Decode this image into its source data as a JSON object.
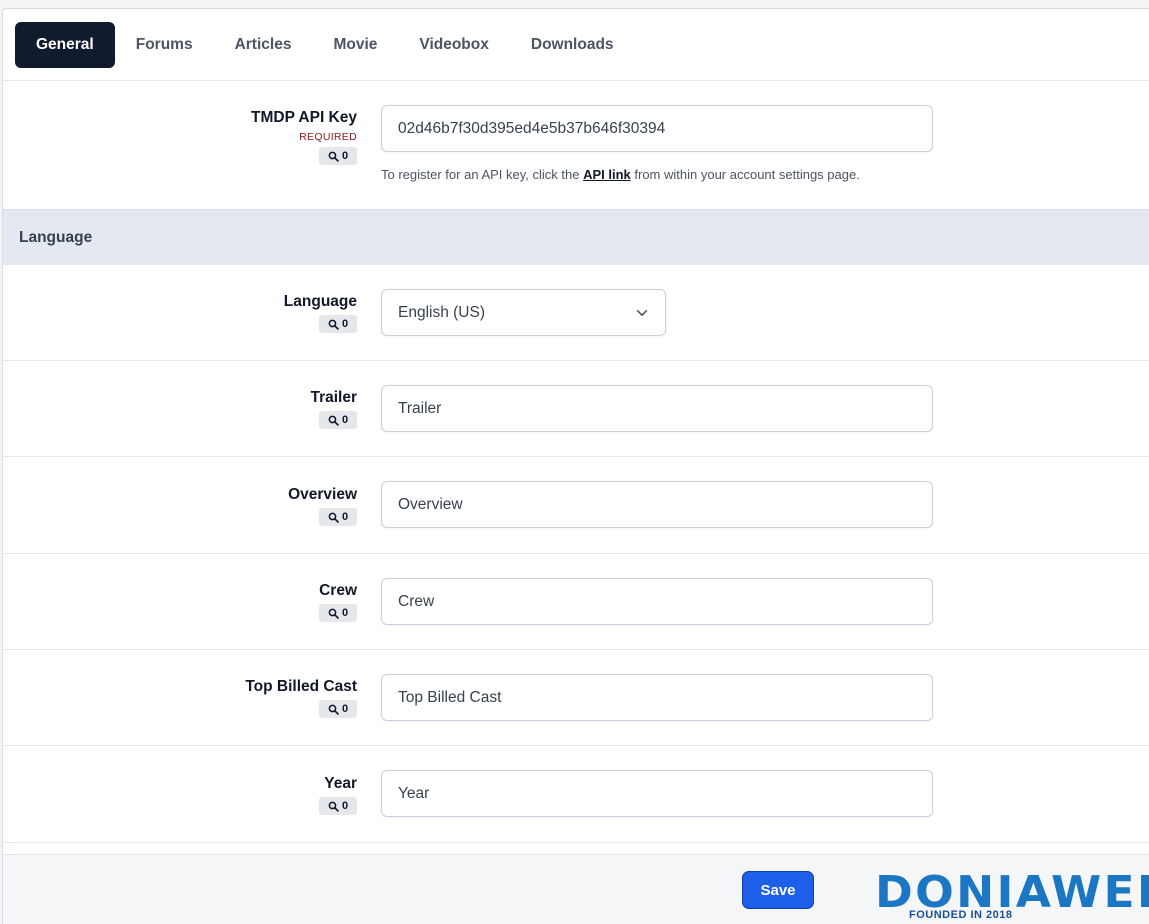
{
  "tabs": [
    {
      "label": "General",
      "active": true
    },
    {
      "label": "Forums",
      "active": false
    },
    {
      "label": "Articles",
      "active": false
    },
    {
      "label": "Movie",
      "active": false
    },
    {
      "label": "Videobox",
      "active": false
    },
    {
      "label": "Downloads",
      "active": false
    }
  ],
  "api_key": {
    "label": "TMDP API Key",
    "required_text": "REQUIRED",
    "search_count": "0",
    "value": "02d46b7f30d395ed4e5b37b646f30394",
    "hint_before": "To register for an API key, click the ",
    "hint_link": "API link",
    "hint_after": " from within your account settings page."
  },
  "section": {
    "title": "Language"
  },
  "fields": {
    "language": {
      "label": "Language",
      "search_count": "0",
      "selected": "English (US)"
    },
    "trailer": {
      "label": "Trailer",
      "search_count": "0",
      "value": "Trailer"
    },
    "overview": {
      "label": "Overview",
      "search_count": "0",
      "value": "Overview"
    },
    "crew": {
      "label": "Crew",
      "search_count": "0",
      "value": "Crew"
    },
    "top_billed_cast": {
      "label": "Top Billed Cast",
      "search_count": "0",
      "value": "Top Billed Cast"
    },
    "year": {
      "label": "Year",
      "search_count": "0",
      "value": "Year"
    }
  },
  "footer": {
    "save_label": "Save"
  },
  "watermark": {
    "brand": "DONIAWEB",
    "tagline": "FOUNDED IN 2018"
  },
  "colors": {
    "active_tab_bg": "#111b2e",
    "primary_button": "#1d5fe8",
    "required_text": "#8b1a1a",
    "section_header_bg": "#e4e8f0",
    "watermark_blue": "#1b76c4"
  }
}
